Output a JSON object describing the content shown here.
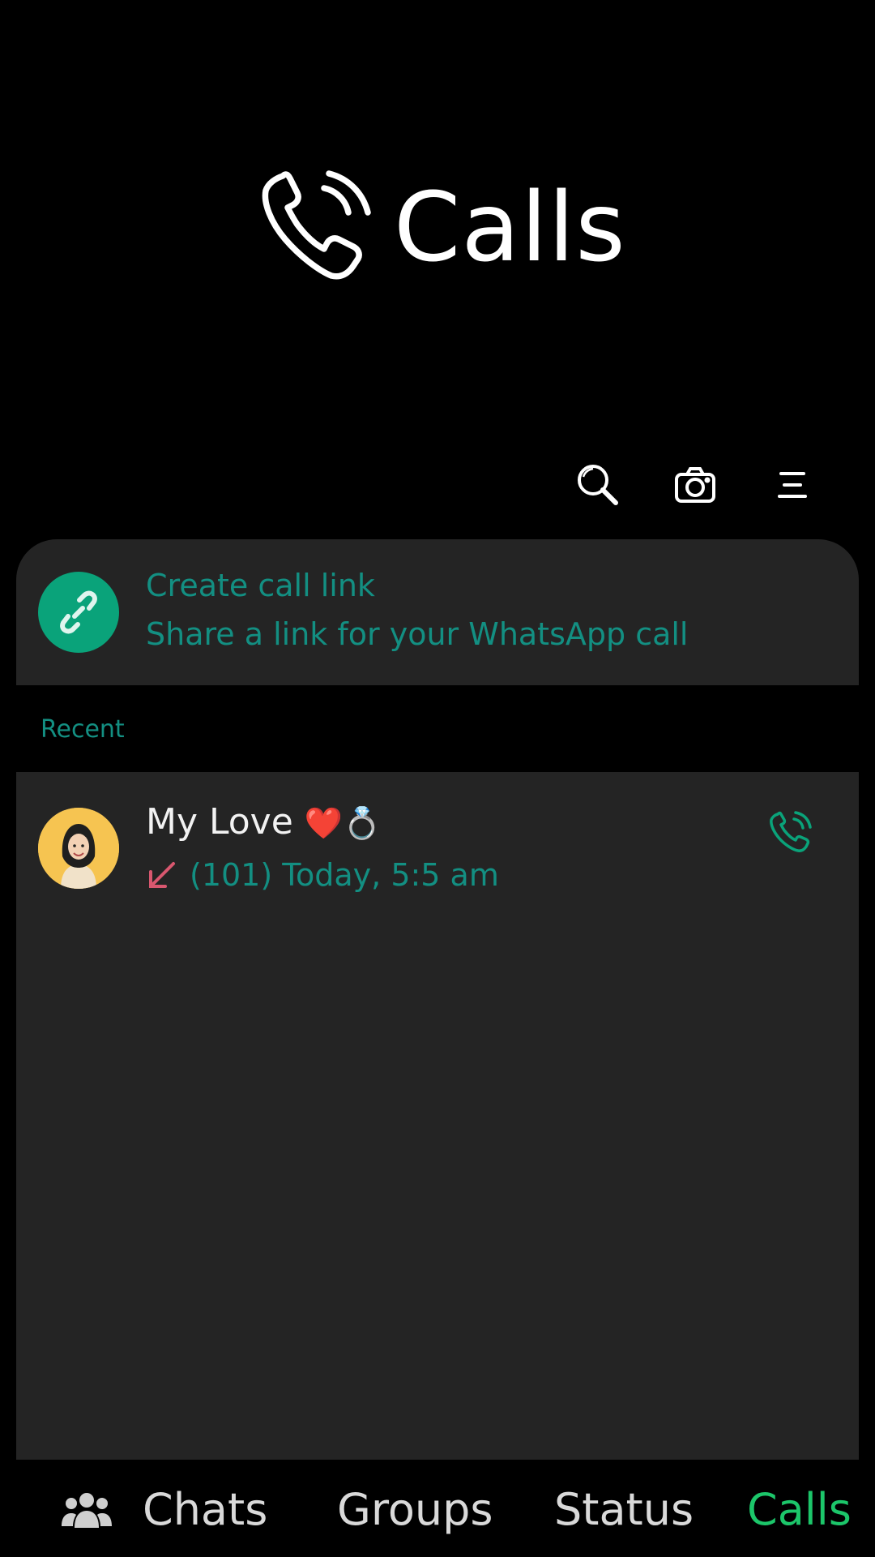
{
  "header": {
    "title": "Calls",
    "icons": [
      "phone-icon",
      "search-icon",
      "camera-icon",
      "menu-icon"
    ]
  },
  "call_link": {
    "title": "Create call link",
    "subtitle": "Share a link for your WhatsApp call",
    "icon": "link-icon"
  },
  "recent": {
    "label": "Recent",
    "items": [
      {
        "name": "My Love",
        "emojis": "❤️💍",
        "call_direction_icon": "incoming-arrow-icon",
        "meta": "(101) Today, 5:5 am",
        "call_icon": "phone-icon"
      }
    ]
  },
  "nav": {
    "items": [
      {
        "label": "Chats",
        "icon": "group-icon"
      },
      {
        "label": "Groups"
      },
      {
        "label": "Status"
      },
      {
        "label": "Calls",
        "active": true
      }
    ]
  },
  "colors": {
    "background": "#000000",
    "card": "#242424",
    "accent": "#138f82",
    "link_avatar": "#0aa37a",
    "active_tab": "#1cc66a",
    "arrow": "#d8576f"
  }
}
